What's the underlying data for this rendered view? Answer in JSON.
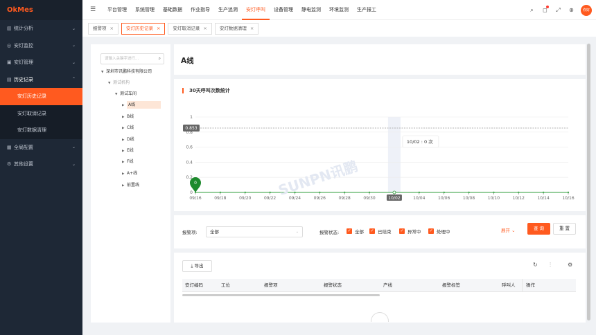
{
  "app": {
    "logo": "OkMes"
  },
  "sidebar": {
    "items": [
      {
        "label": "统计分析",
        "icon": "chart-icon",
        "open": false
      },
      {
        "label": "安灯监控",
        "icon": "monitor-icon",
        "open": false
      },
      {
        "label": "安灯管理",
        "icon": "manage-icon",
        "open": false
      },
      {
        "label": "历史记录",
        "icon": "history-icon",
        "open": true,
        "children": [
          {
            "label": "安灯历史记录",
            "active": true
          },
          {
            "label": "安灯取消记录",
            "active": false
          },
          {
            "label": "安灯数据清理",
            "active": false
          }
        ]
      },
      {
        "label": "全局配置",
        "icon": "config-icon",
        "open": false
      },
      {
        "label": "其他设置",
        "icon": "settings-icon",
        "open": false
      }
    ]
  },
  "topnav": {
    "items": [
      "平台管理",
      "系统管理",
      "基础数据",
      "作业指导",
      "生产追溯",
      "安灯呼叫",
      "设备管理",
      "静电监测",
      "环境监测",
      "生产报工"
    ],
    "active_index": 5,
    "avatar": "你好"
  },
  "tabs": [
    {
      "label": "报警项",
      "active": false
    },
    {
      "label": "安灯历史记录",
      "active": true
    },
    {
      "label": "安灯取消记录",
      "active": false
    },
    {
      "label": "安灯数据清理",
      "active": false
    }
  ],
  "tree": {
    "search_placeholder": "请输入关键字进行...",
    "nodes": [
      {
        "label": "深圳市讯鹏科技有限公司",
        "level": 0,
        "expanded": true,
        "grey": false
      },
      {
        "label": "测试机构",
        "level": 1,
        "expanded": true,
        "grey": true
      },
      {
        "label": "测试车间",
        "level": 2,
        "expanded": true,
        "grey": false
      },
      {
        "label": "A线",
        "level": 3,
        "selected": true
      },
      {
        "label": "B线",
        "level": 3
      },
      {
        "label": "C线",
        "level": 3
      },
      {
        "label": "D线",
        "level": 3
      },
      {
        "label": "E线",
        "level": 3
      },
      {
        "label": "F线",
        "level": 3
      },
      {
        "label": "A+线",
        "level": 3
      },
      {
        "label": "前置线",
        "level": 3
      }
    ]
  },
  "main": {
    "title": "A线"
  },
  "chart_data": {
    "type": "line",
    "title": "30天呼叫次数统计",
    "categories": [
      "09/16",
      "09/18",
      "09/20",
      "09/22",
      "09/24",
      "09/26",
      "09/28",
      "09/30",
      "10/02",
      "10/04",
      "10/06",
      "10/08",
      "10/10",
      "10/12",
      "10/14",
      "10/16"
    ],
    "values": [
      0,
      0,
      0,
      0,
      0,
      0,
      0,
      0,
      0,
      0,
      0,
      0,
      0,
      0,
      0,
      0
    ],
    "ylim": [
      0,
      1
    ],
    "yticks": [
      "0",
      "0.2",
      "0.4",
      "0.6",
      "0.8",
      "1"
    ],
    "markline": {
      "value": "0.853"
    },
    "marker_point": {
      "x": "09/16",
      "label": "0"
    },
    "highlight": "10/02",
    "tooltip": "10/02 : 0 次",
    "grid": true,
    "series_color": "#2e9e3a"
  },
  "watermark": "SUNPN讯鹏",
  "filter": {
    "alarm_label": "报警项:",
    "alarm_value": "全部",
    "status_label": "报警状态:",
    "statuses": [
      "全部",
      "已结束",
      "异常中",
      "处理中"
    ],
    "expand_label": "展开",
    "query_label": "查 询",
    "reset_label": "重 置"
  },
  "table": {
    "export_label": "导出",
    "columns": [
      "安灯编码",
      "工位",
      "报警项",
      "报警状态",
      "产线",
      "报警标签",
      "呼叫人",
      "操作"
    ]
  },
  "colors": {
    "accent": "#ff5a1f",
    "sidebar": "#1e2836"
  }
}
